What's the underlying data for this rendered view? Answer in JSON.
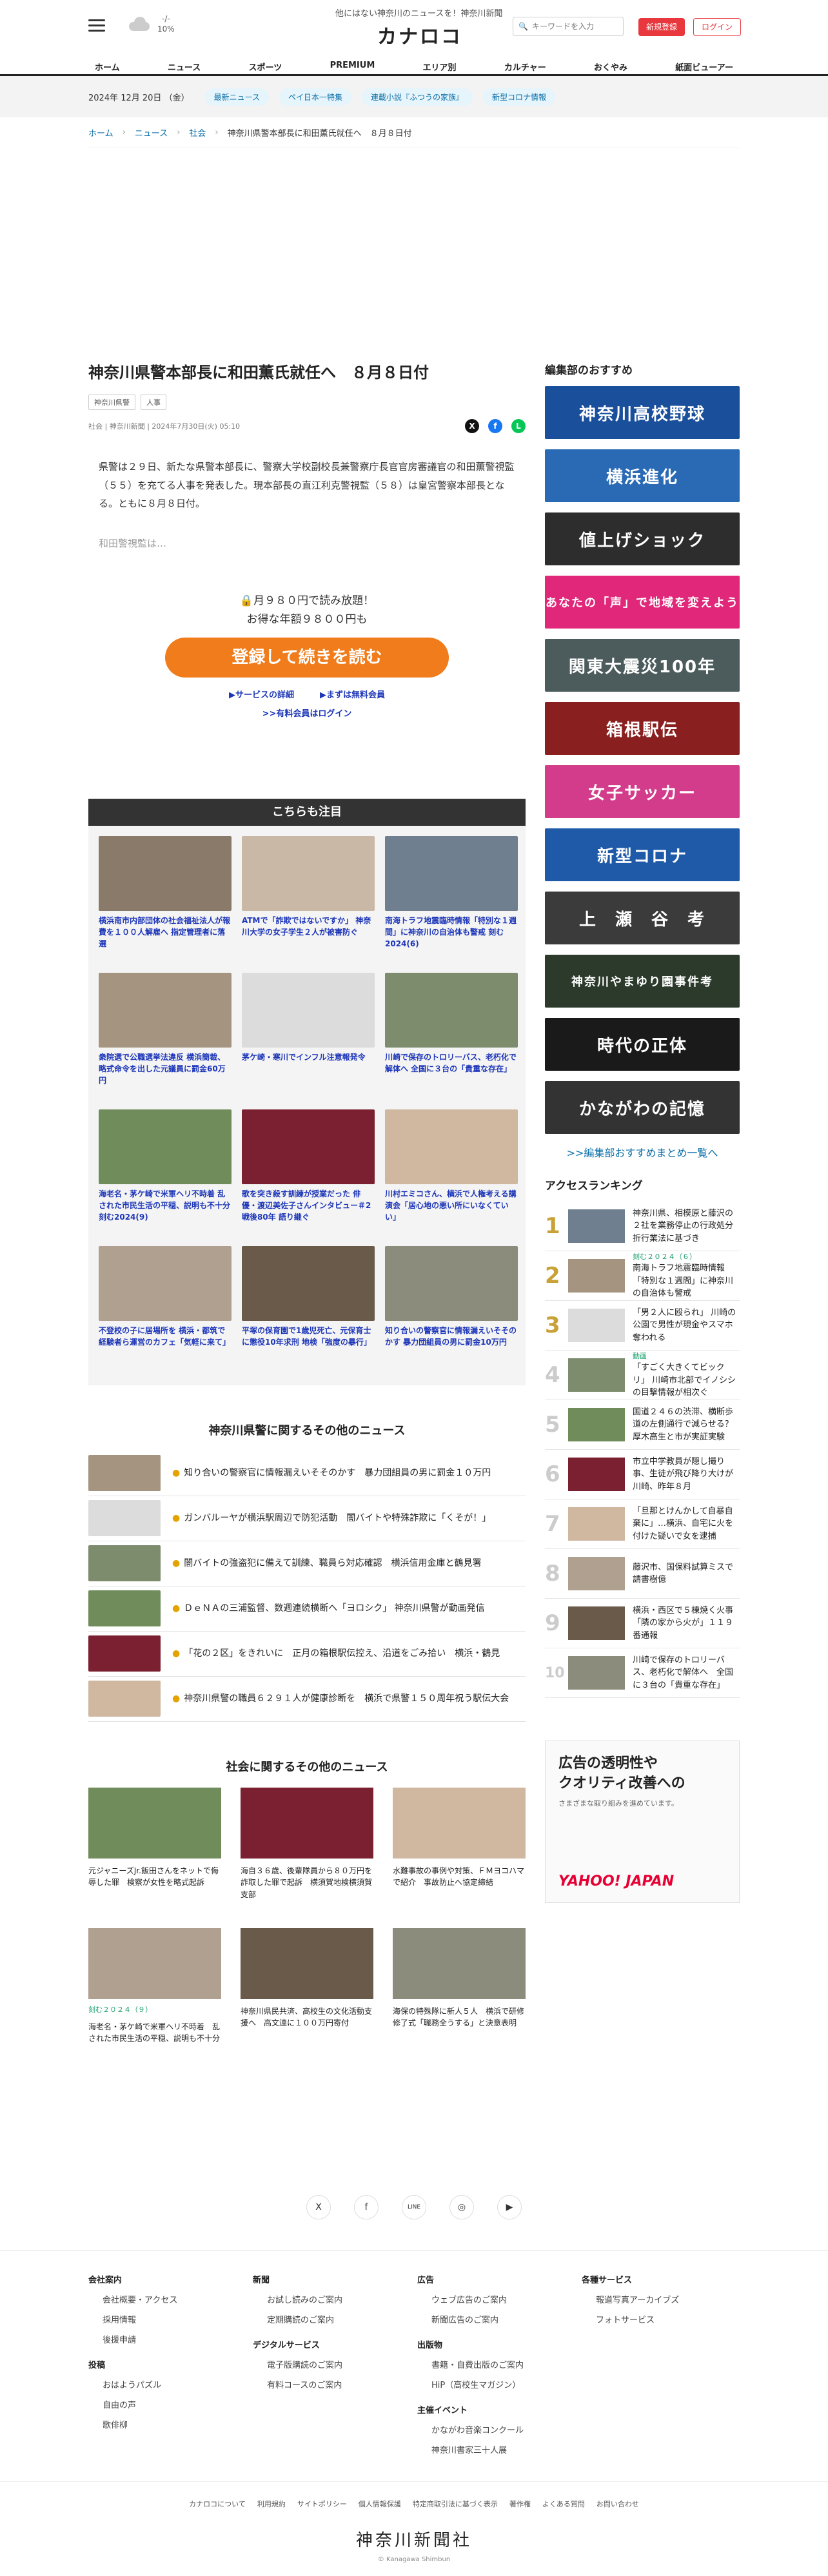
{
  "header": {
    "tagline": "他にはない神奈川のニュースを！神奈川新聞",
    "logo": "カナロコ",
    "weather_temp": "-/-",
    "weather_sub": "10%",
    "search_placeholder": "キーワードを入力",
    "register_label": "新規登録",
    "login_label": "ログイン"
  },
  "nav": [
    "ホーム",
    "ニュース",
    "スポーツ",
    "PREMIUM",
    "エリア別",
    "カルチャー",
    "おくやみ",
    "紙面ビューアー"
  ],
  "datebar": {
    "date": "2024年 12月 20日 （金）",
    "pills": [
      "最新ニュース",
      "ペイ日本一特集",
      "連載小説『ふつうの家族』",
      "新型コロナ情報"
    ]
  },
  "breadcrumb": [
    "ホーム",
    "ニュース",
    "社会",
    "神奈川県警本部長に和田薫氏就任へ　８月８日付"
  ],
  "article": {
    "title": "神奈川県警本部長に和田薫氏就任へ　８月８日付",
    "tags": [
      "神奈川県警",
      "人事"
    ],
    "meta": "社会 | 神奈川新聞 | 2024年7月30日(火) 05:10",
    "body": "県警は２９日、新たな県警本部長に、警察大学校副校長兼警察庁長官官房審議官の和田薫警視監（５５）を充てる人事を発表した。現本部長の直江利克警視監（５８）は皇宮警察本部長となる。ともに８月８日付。",
    "teaser": "和田警視監は…"
  },
  "paywall": {
    "line1": "🔒月９８０円で読み放題！",
    "line2": "お得な年額９８００円も",
    "button": "登録して続きを読む",
    "link1": "▶サービスの詳細",
    "link2": "▶まずは無料会員",
    "link3": ">>有料会員はログイン"
  },
  "notice": {
    "title": "こちらも注目",
    "items": [
      "横浜南市内部団体の社会福祉法人が報費を１００人解雇へ 指定管理者に落選",
      "ATMで「詐欺ではないですか」 神奈川大学の女子学生２人が被害防ぐ",
      "南海トラフ地震臨時情報「特別な１週間」に神奈川の自治体も警戒 刻む2024(6)",
      "衆院選で公職選挙法違反 横浜簡裁、略式命令を出した元議員に罰金60万円",
      "茅ケ崎・寒川でインフル注意報発令",
      "川崎で保存のトロリーバス、老朽化で解体へ 全国に３台の「貴重な存在」",
      "海老名・茅ケ崎で米軍ヘリ不時着 乱された市民生活の平穏、説明も不十分 刻む2024(9)",
      "歌を突き殺す訓練が授業だった 俳優・渡辺美佐子さんインタビュー＃2 戦後80年 語り継ぐ",
      "川村エミコさん、横浜で人権考える講演会「居心地の悪い所にいなくていい」",
      "不登校の子に居場所を 横浜・都筑で経験者ら運営のカフェ「気軽に来て」",
      "平塚の保育園で1歳児死亡、元保育士に懲役10年求刑 地検「強度の暴行」",
      "知り合いの警察官に情報漏えいそそのかす 暴力団組員の男に罰金10万円"
    ]
  },
  "police_news": {
    "title": "神奈川県警に関するその他のニュース",
    "items": [
      "知り合いの警察官に情報漏えいそそのかす　暴力団組員の男に罰金１０万円",
      "ガンバルーヤが横浜駅周辺で防犯活動　闇バイトや特殊詐欺に「くそが！」",
      "闇バイトの強盗犯に備えて訓練、職員ら対応確認　横浜信用金庫と鶴見署",
      "ＤｅＮＡの三浦監督、数週連続横断へ「ヨロシク」 神奈川県警が動画発信",
      "「花の２区」をきれいに　正月の箱根駅伝控え、沿道をごみ拾い　横浜・鶴見",
      "神奈川県警の職員６２９１人が健康診断を　横浜で県警１５０周年祝う駅伝大会"
    ]
  },
  "society_news": {
    "title": "社会に関するその他のニュース",
    "items": [
      {
        "badge": "",
        "text": "元ジャニーズJr.飯田さんをネットで侮辱した罪　検察が女性を略式起訴"
      },
      {
        "badge": "",
        "text": "海自３６歳、後輩隊員から８０万円を詐取した罪で起訴　横須賀地検横須賀支部"
      },
      {
        "badge": "",
        "text": "水難事故の事例や対策、ＦＭヨコハマで紹介　事故防止へ協定締結"
      },
      {
        "badge": "刻む２０２４（９）",
        "text": "海老名・茅ケ崎で米軍ヘリ不時着　乱された市民生活の平穏、説明も不十分"
      },
      {
        "badge": "",
        "text": "神奈川県民共済、高校生の文化活動支援へ　高文連に１００万円寄付"
      },
      {
        "badge": "",
        "text": "海保の特殊隊に新人５人　横浜で研修修了式「職務全うする」と決意表明"
      }
    ]
  },
  "sidebar": {
    "recommend_title": "編集部のおすすめ",
    "banners": [
      "神奈川高校野球",
      "横浜進化",
      "値上げショック",
      "あなたの「声」で地域を変えよう",
      "関東大震災100年",
      "箱根駅伝",
      "女子サッカー",
      "新型コロナ",
      "上　瀬　谷　考",
      "神奈川やまゆり園事件考",
      "時代の正体",
      "かながわの記憶"
    ],
    "more": ">>編集部おすすめまとめ一覧へ",
    "ranking_title": "アクセスランキング",
    "ranking": [
      {
        "no": "1",
        "badge": "",
        "text": "神奈川県、相模原と藤沢の２社を業務停止の行政処分 折行業法に基づき"
      },
      {
        "no": "2",
        "badge": "刻む２０２４（６）",
        "text": "南海トラフ地震臨時情報「特別な１週間」に神奈川の自治体も警戒"
      },
      {
        "no": "3",
        "badge": "",
        "text": "「男２人に殴られ」 川崎の公園で男性が現金やスマホ奪われる"
      },
      {
        "no": "4",
        "badge": "動画",
        "text": "「すごく大きくてビックリ」 川崎市北部でイノシシの目撃情報が相次ぐ"
      },
      {
        "no": "5",
        "badge": "",
        "text": "国道２４６の渋滞、横断歩道の左側通行で減らせる？ 厚木高生と市が実証実験"
      },
      {
        "no": "6",
        "badge": "",
        "text": "市立中学教員が隠し撮り事、生徒が飛び降り大けが 川崎、昨年８月"
      },
      {
        "no": "7",
        "badge": "",
        "text": "「旦那とけんかして自暴自棄に」…横浜、自宅に火を付けた疑いで女を逮捕"
      },
      {
        "no": "8",
        "badge": "",
        "text": "藤沢市、国保料試算ミスで請書樹億"
      },
      {
        "no": "9",
        "badge": "",
        "text": "横浜・西区で５棟焼く火事「隣の家から火が」１１９番通報"
      },
      {
        "no": "10",
        "badge": "",
        "text": "川崎で保存のトロリーバス、老朽化で解体へ　全国に３台の「貴重な存在」"
      }
    ],
    "ad_line1": "広告の透明性や",
    "ad_line2": "クオリティ改善への",
    "ad_line3": "さまざまな取り組みを進めています。",
    "ad_brand": "YAHOO! JAPAN"
  },
  "footer": {
    "social": [
      "X",
      "f",
      "LINE",
      "◎",
      "▶"
    ],
    "cols": [
      {
        "h": "会社案内",
        "items": [
          "会社概要・アクセス",
          "採用情報",
          "後援申請"
        ],
        "h2": "投稿",
        "items2": [
          "おはようパズル",
          "自由の声",
          "歌俳柳"
        ]
      },
      {
        "h": "新聞",
        "items": [
          "お試し読みのご案内",
          "定期購読のご案内"
        ],
        "h2": "デジタルサービス",
        "items2": [
          "電子版購読のご案内",
          "有料コースのご案内"
        ]
      },
      {
        "h": "広告",
        "items": [
          "ウェブ広告のご案内",
          "新聞広告のご案内"
        ],
        "h2": "出版物",
        "items2": [
          "書籍・自費出版のご案内",
          "HiP（高校生マガジン）"
        ],
        "h3": "主催イベント",
        "items3": [
          "かながわ音楽コンクール",
          "神奈川書家三十人展"
        ]
      },
      {
        "h": "各種サービス",
        "items": [
          "報道写真アーカイブズ",
          "フォトサービス"
        ]
      }
    ],
    "bottom_links": [
      "カナロコについて",
      "利用規約",
      "サイトポリシー",
      "個人情報保護",
      "特定商取引法に基づく表示",
      "著作権",
      "よくある質問",
      "お問い合わせ"
    ],
    "logo": "神奈川新聞社",
    "copyright": "© Kanagawa Shimbun"
  },
  "colors": {
    "accent_red": "#e8383d",
    "accent_orange": "#f07c1b",
    "link_blue": "#1d36b8"
  }
}
